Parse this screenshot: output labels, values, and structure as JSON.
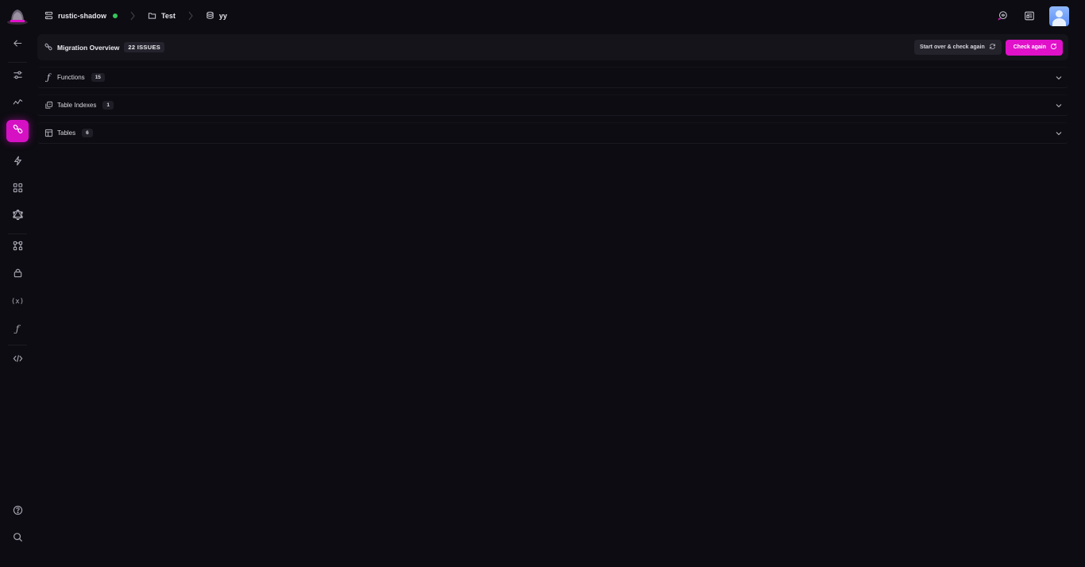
{
  "breadcrumb": {
    "project": "rustic-shadow",
    "folder": "Test",
    "database": "yy"
  },
  "colors": {
    "accent": "#e011c9",
    "status_online": "#34c759",
    "background": "#0d0c12"
  },
  "sidebar": {
    "items": [
      {
        "name": "back",
        "icon": "arrow-left-icon"
      },
      {
        "name": "settings",
        "icon": "sliders-icon"
      },
      {
        "name": "monitoring",
        "icon": "activity-icon"
      },
      {
        "name": "migration",
        "icon": "link-icon",
        "active": true
      },
      {
        "name": "functions-lightning",
        "icon": "bolt-icon"
      },
      {
        "name": "apps",
        "icon": "grid-icon"
      },
      {
        "name": "graphql",
        "icon": "graphql-icon"
      },
      {
        "name": "workflows",
        "icon": "nodes-icon"
      },
      {
        "name": "security",
        "icon": "lock-icon"
      },
      {
        "name": "variables",
        "icon": "variables-icon"
      },
      {
        "name": "functions",
        "icon": "function-icon"
      },
      {
        "name": "code",
        "icon": "code-icon"
      },
      {
        "name": "help",
        "icon": "help-icon"
      },
      {
        "name": "search",
        "icon": "search-icon"
      }
    ],
    "variables_label": "(x)",
    "function_label": "ƒ"
  },
  "overview": {
    "title": "Migration Overview",
    "issues_badge": "22 ISSUES",
    "start_over_label": "Start over & check again",
    "check_again_label": "Check again"
  },
  "sections": [
    {
      "label": "Functions",
      "count": "15",
      "icon": "function-icon"
    },
    {
      "label": "Table Indexes",
      "count": "1",
      "icon": "index-icon"
    },
    {
      "label": "Tables",
      "count": "6",
      "icon": "table-icon"
    }
  ]
}
